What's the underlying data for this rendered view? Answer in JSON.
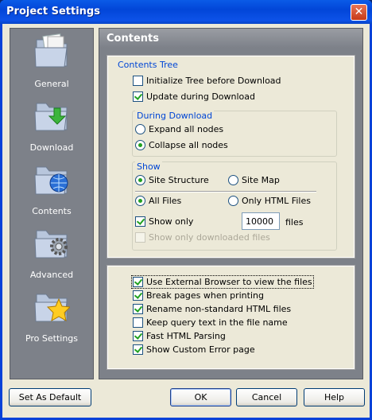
{
  "window": {
    "title": "Project Settings",
    "close_glyph": "✕"
  },
  "sidebar": {
    "items": [
      {
        "label": "General",
        "icon": "general-folder-icon"
      },
      {
        "label": "Download",
        "icon": "download-folder-icon"
      },
      {
        "label": "Contents",
        "icon": "contents-folder-icon"
      },
      {
        "label": "Advanced",
        "icon": "advanced-folder-icon"
      },
      {
        "label": "Pro Settings",
        "icon": "pro-settings-folder-icon"
      }
    ]
  },
  "main": {
    "header": "Contents",
    "contents_tree": {
      "title": "Contents Tree",
      "initialize_tree": {
        "label": "Initialize Tree before Download",
        "checked": false
      },
      "update_during": {
        "label": "Update during Download",
        "checked": true
      },
      "during_download": {
        "title": "During Download",
        "expand_all": {
          "label": "Expand all nodes",
          "selected": false
        },
        "collapse_all": {
          "label": "Collapse all nodes",
          "selected": true
        }
      },
      "show": {
        "title": "Show",
        "site_structure": {
          "label": "Site Structure",
          "selected": true
        },
        "site_map": {
          "label": "Site Map",
          "selected": false
        },
        "all_files": {
          "label": "All Files",
          "selected": true
        },
        "only_html": {
          "label": "Only HTML Files",
          "selected": false
        },
        "show_only": {
          "label": "Show only",
          "checked": true,
          "value": "10000",
          "suffix": "files"
        },
        "show_only_downloaded": {
          "label": "Show only downloaded files",
          "checked": false,
          "enabled": false
        }
      }
    },
    "options": [
      {
        "label": "Use External Browser to view the files",
        "checked": true
      },
      {
        "label": "Break pages when printing",
        "checked": true
      },
      {
        "label": "Rename non-standard HTML files",
        "checked": true
      },
      {
        "label": "Keep query text in the file name",
        "checked": false
      },
      {
        "label": "Fast HTML Parsing",
        "checked": true
      },
      {
        "label": "Show Custom Error page",
        "checked": true
      }
    ]
  },
  "footer": {
    "set_default": "Set As Default",
    "ok": "OK",
    "cancel": "Cancel",
    "help": "Help"
  }
}
